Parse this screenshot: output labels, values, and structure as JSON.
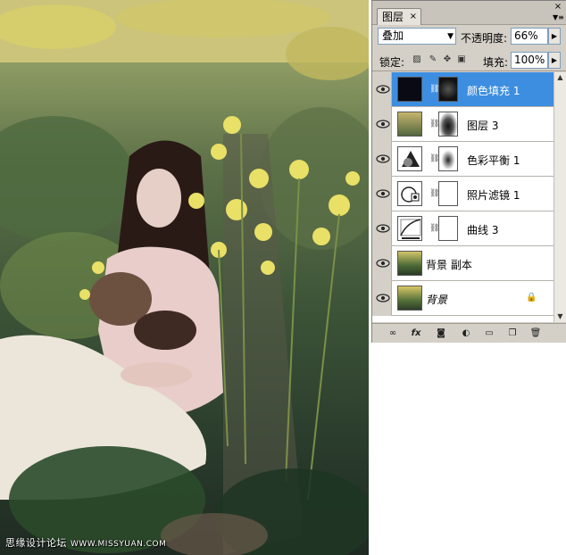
{
  "panel": {
    "tab_label": "图层",
    "tab_close": "×",
    "blend_mode": "叠加",
    "opacity_label": "不透明度:",
    "opacity_value": "66%",
    "lock_label": "锁定:",
    "fill_label": "填充:",
    "fill_value": "100%"
  },
  "layers": [
    {
      "name": "颜色填充 1",
      "selected": true
    },
    {
      "name": "图层 3",
      "selected": false
    },
    {
      "name": "色彩平衡 1",
      "selected": false
    },
    {
      "name": "照片滤镜 1",
      "selected": false
    },
    {
      "name": "曲线 3",
      "selected": false
    },
    {
      "name": "背景 副本",
      "selected": false
    },
    {
      "name": "背景",
      "selected": false,
      "locked": true
    }
  ],
  "footer": {
    "icons": [
      "link-icon",
      "fx-icon",
      "add-mask-icon",
      "adjustment-icon",
      "group-folder-icon",
      "new-layer-icon",
      "trash-icon"
    ]
  },
  "watermark": {
    "text": "思缘设计论坛",
    "url": "WWW.MISSYUAN.COM"
  },
  "colors": {
    "selected_layer": "#3d8ee0",
    "panel_bg": "#d4d0c8"
  }
}
